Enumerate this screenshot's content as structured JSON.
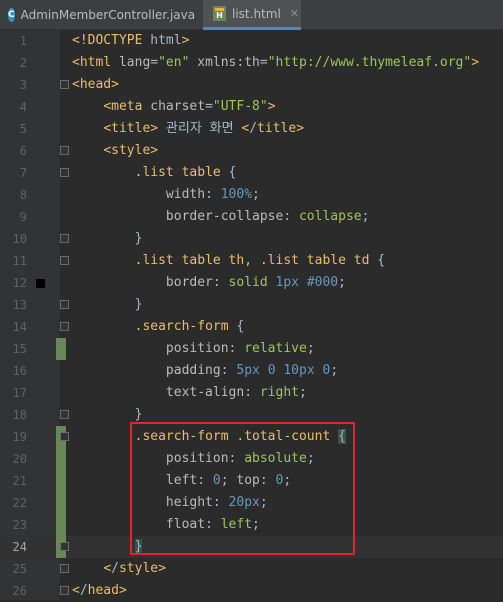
{
  "tabs": [
    {
      "label": "AdminMemberController.java",
      "icon": "java-class-icon",
      "active": false
    },
    {
      "label": "list.html",
      "icon": "html-file-icon",
      "active": true
    }
  ],
  "current_line": 24,
  "modified_lines": [
    15,
    19,
    20,
    21,
    22,
    23,
    24
  ],
  "lines": [
    {
      "n": "1",
      "text": "<!DOCTYPE html>"
    },
    {
      "n": "2",
      "text": "<html lang=\"en\" xmlns:th=\"http://www.thymeleaf.org\">"
    },
    {
      "n": "3",
      "text": "<head>"
    },
    {
      "n": "4",
      "text": "    <meta charset=\"UTF-8\">"
    },
    {
      "n": "5",
      "text": "    <title> 관리자 화면 </title>"
    },
    {
      "n": "6",
      "text": "    <style>"
    },
    {
      "n": "7",
      "text": "        .list table {"
    },
    {
      "n": "8",
      "text": "            width: 100%;"
    },
    {
      "n": "9",
      "text": "            border-collapse: collapse;"
    },
    {
      "n": "10",
      "text": "        }"
    },
    {
      "n": "11",
      "text": "        .list table th, .list table td {"
    },
    {
      "n": "12",
      "text": "            border: solid 1px #000;"
    },
    {
      "n": "13",
      "text": "        }"
    },
    {
      "n": "14",
      "text": "        .search-form {"
    },
    {
      "n": "15",
      "text": "            position: relative;"
    },
    {
      "n": "16",
      "text": "            padding: 5px 0 10px 0;"
    },
    {
      "n": "17",
      "text": "            text-align: right;"
    },
    {
      "n": "18",
      "text": "        }"
    },
    {
      "n": "19",
      "text": "        .search-form .total-count {"
    },
    {
      "n": "20",
      "text": "            position: absolute;"
    },
    {
      "n": "21",
      "text": "            left: 0; top: 0;"
    },
    {
      "n": "22",
      "text": "            height: 20px;"
    },
    {
      "n": "23",
      "text": "            float: left;"
    },
    {
      "n": "24",
      "text": "        }"
    },
    {
      "n": "25",
      "text": "    </style>"
    },
    {
      "n": "26",
      "text": "</head>"
    }
  ],
  "colors": {
    "background": "#2b2b2b",
    "tag": "#e8bf6a",
    "attribute_value": "#a5c25c",
    "number": "#6897bb",
    "annotation_box": "#e0252b"
  }
}
